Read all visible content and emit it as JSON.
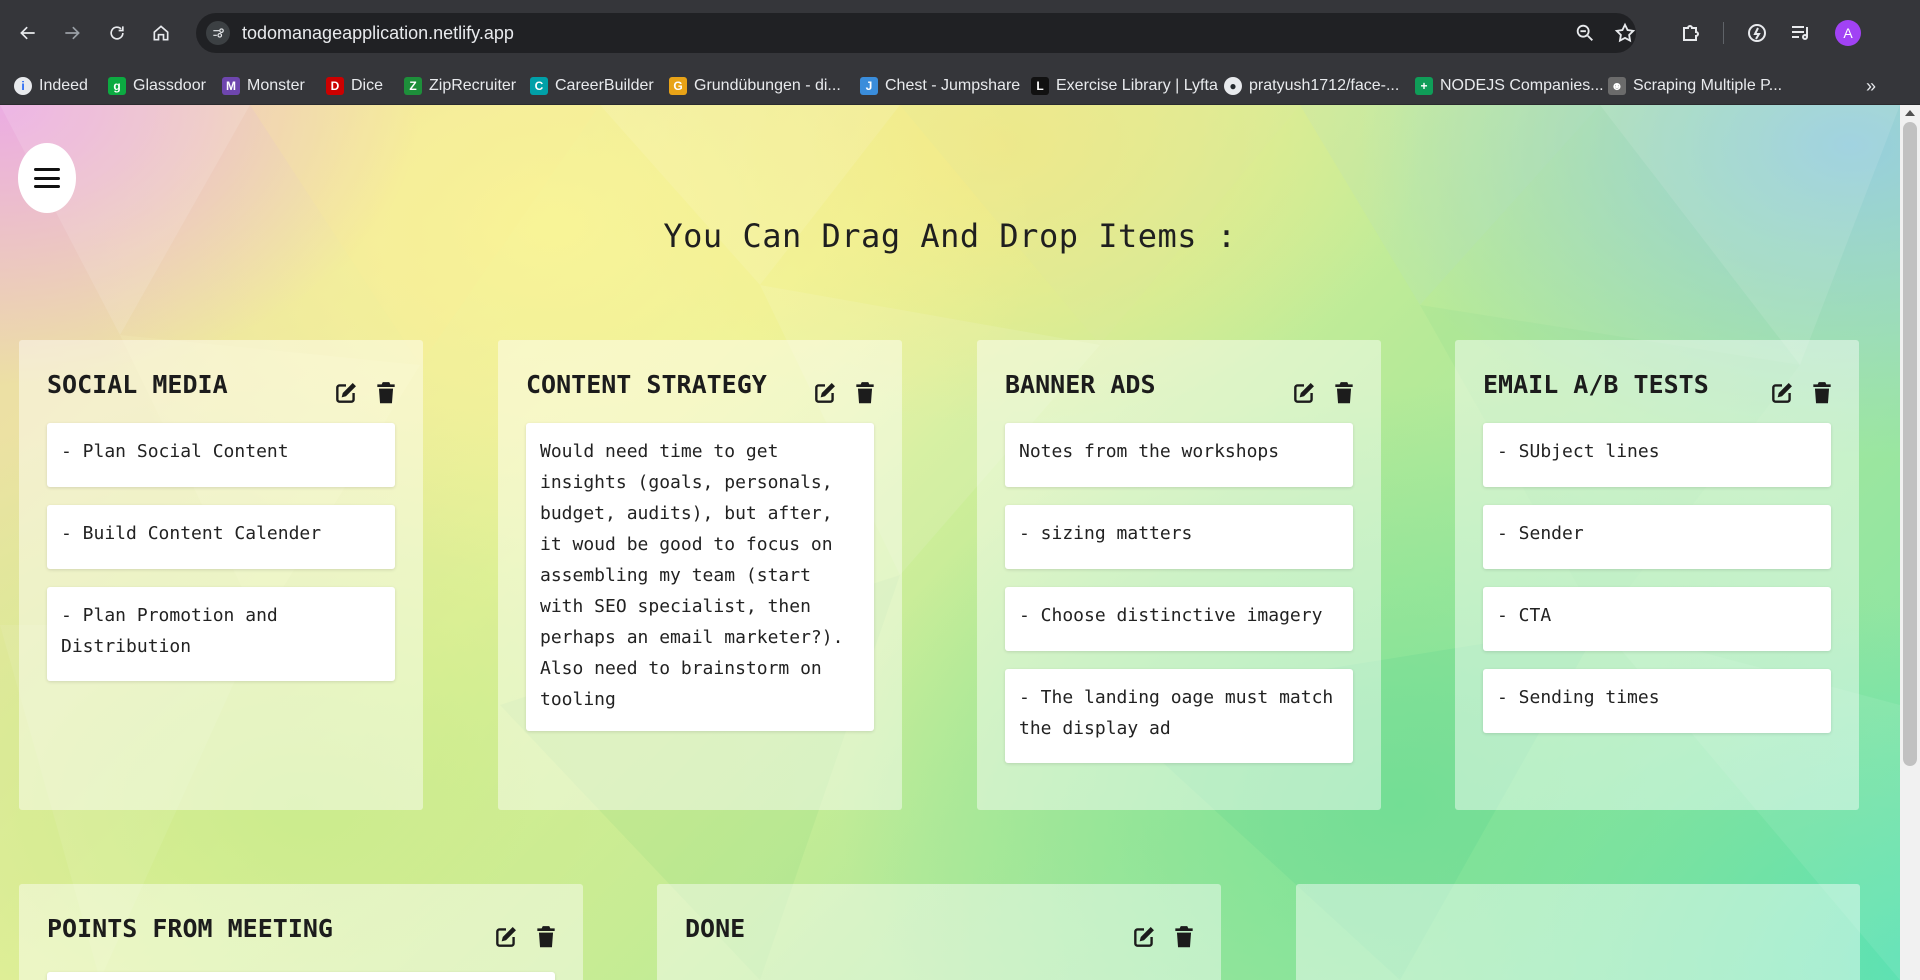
{
  "browser": {
    "url": "todomanageapplication.netlify.app",
    "profile_initial": "A",
    "bookmarks": [
      {
        "label": "Indeed",
        "icon": "indeed-icon",
        "color": "#2164f3",
        "glyph": "i"
      },
      {
        "label": "Glassdoor",
        "icon": "glassdoor-icon",
        "color": "#0caa41",
        "glyph": "g"
      },
      {
        "label": "Monster",
        "icon": "monster-icon",
        "color": "#6e46ae",
        "glyph": "M"
      },
      {
        "label": "Dice",
        "icon": "dice-icon",
        "color": "#cc0000",
        "glyph": "D"
      },
      {
        "label": "ZipRecruiter",
        "icon": "ziprecruiter-icon",
        "color": "#1d8f3a",
        "glyph": "Z"
      },
      {
        "label": "CareerBuilder",
        "icon": "careerbuilder-icon",
        "color": "#00a0a8",
        "glyph": "C"
      },
      {
        "label": "Grundübungen - di...",
        "icon": "gym-icon",
        "color": "#e8a317",
        "glyph": "G"
      },
      {
        "label": "Chest - Jumpshare",
        "icon": "jumpshare-icon",
        "color": "#3a8ddb",
        "glyph": "J"
      },
      {
        "label": "Exercise Library | Lyfta",
        "icon": "lyfta-icon",
        "color": "#111111",
        "glyph": "L"
      },
      {
        "label": "pratyush1712/face-...",
        "icon": "github-icon",
        "color": "#24292e",
        "glyph": "⬤"
      },
      {
        "label": "NODEJS Companies...",
        "icon": "sheets-icon",
        "color": "#0f9d58",
        "glyph": "+"
      },
      {
        "label": "Scraping Multiple P...",
        "icon": "scraper-icon",
        "color": "#6b6b6b",
        "glyph": "☻"
      }
    ]
  },
  "page": {
    "heading": "You Can Drag And Drop Items :"
  },
  "boards": [
    {
      "title": "SOCIAL MEDIA",
      "cards": [
        "- Plan Social Content",
        "- Build Content Calender",
        "- Plan Promotion and Distribution"
      ]
    },
    {
      "title": "CONTENT STRATEGY",
      "cards": [
        "Would need time to get insights (goals, personals, budget, audits), but after, it woud be good to focus on assembling my team (start with SEO specialist, then perhaps an email marketer?). Also need to brainstorm on tooling"
      ]
    },
    {
      "title": "BANNER ADS",
      "cards": [
        "Notes from the workshops",
        "- sizing matters",
        "- Choose distinctive imagery",
        "- The landing oage must match the display ad"
      ]
    },
    {
      "title": "EMAIL A/B TESTS",
      "cards": [
        "- SUbject lines",
        "- Sender",
        "- CTA",
        "- Sending times"
      ]
    },
    {
      "title": "POINTS FROM MEETING",
      "cards": []
    },
    {
      "title": "DONE",
      "cards": []
    },
    {
      "title": "",
      "cards": []
    }
  ]
}
